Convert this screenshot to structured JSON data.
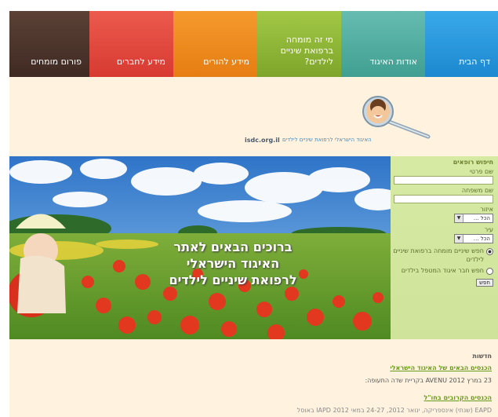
{
  "nav": {
    "forum": "פורום מומחים",
    "friends": "מידע לחברים",
    "parents": "מידע להורים",
    "expert": "מי זה מומחה ברפואת שיניים לילדים?",
    "about": "אודות האיגוד",
    "home": "דף הבית"
  },
  "logo": {
    "site": "isdc.org.il",
    "tagline": "האיגוד הישראלי לרפואת שיניים לילדים"
  },
  "hero": {
    "line1": "ברוכים הבאים לאתר",
    "line2": "האיגוד הישראלי",
    "line3": "לרפואת שיניים לילדים"
  },
  "search": {
    "title": "חיפוש רופאים",
    "first_name_label": "שם פרטי",
    "last_name_label": "שם משפחה",
    "area_label": "איזור",
    "area_value": "הכל ...",
    "city_label": "עיר",
    "city_value": "הכל ...",
    "radio1": "חפש שיניים מומחה ברפואת שיניים לילדים",
    "radio2": "חפש חבר איגוד המטפל בילדים",
    "button": "חפש"
  },
  "news": {
    "title": "חדשות",
    "item1_link": "הכנסים הבאים של האיגוד הישראלי",
    "item1_text": "23 במרץ 2012 AVENU בקריית שדה התעופה:",
    "item2_link": "הכנסים הקרובים בחו\"ל",
    "item2_text": "EAPD (שנתי) אינספריקה, ינואר 2012, 24-27 במאי 2012 IAPD באוסל"
  },
  "colors": {
    "forum": "#4e352b",
    "friends": "#e2483f",
    "parents": "#ef8c20",
    "expert": "#91b83a",
    "about": "#53ae a1",
    "home": "#2a98dc",
    "page_bg": "#fff3df",
    "search_bg": "#d3e69f",
    "news_link": "#6a9a1a"
  }
}
